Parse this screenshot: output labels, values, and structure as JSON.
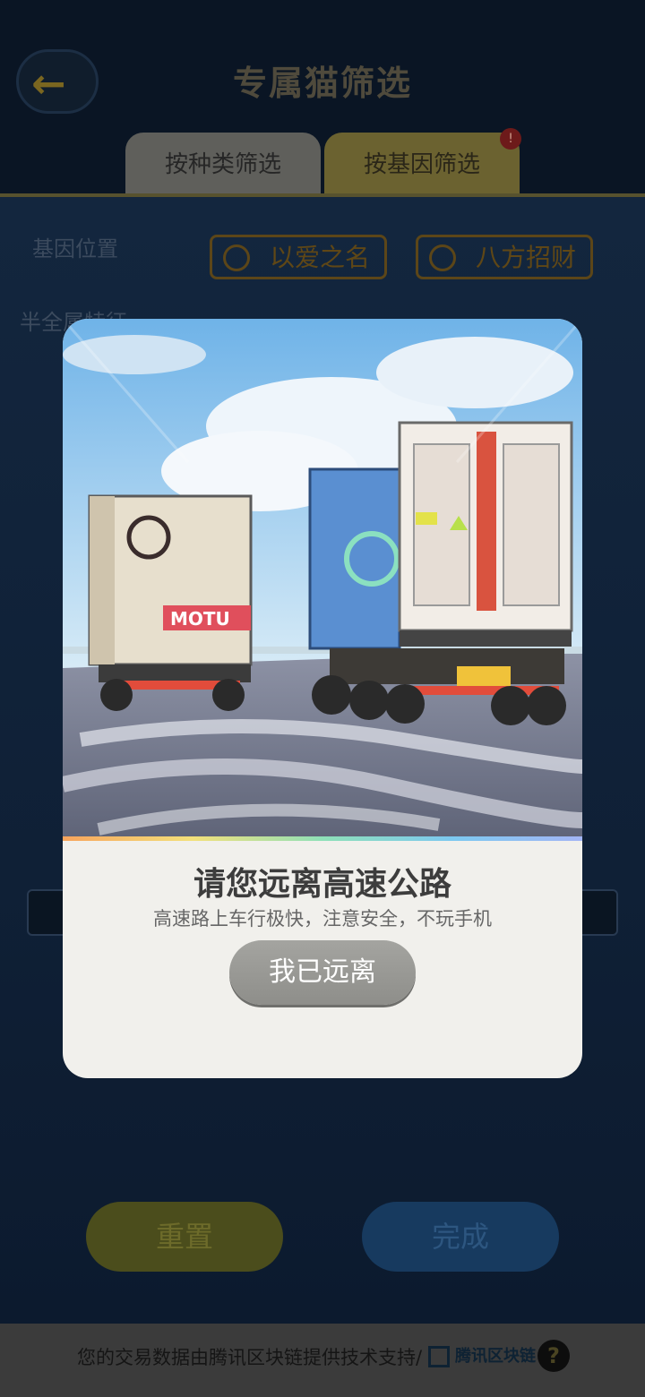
{
  "header": {
    "title": "专属猫筛选",
    "tabs": [
      {
        "label": "按种类筛选"
      },
      {
        "label": "按基因筛选",
        "badge": "!"
      }
    ]
  },
  "filters": {
    "rows": [
      {
        "label": "基因位置"
      },
      {
        "label": "半全属特征"
      }
    ],
    "chips": [
      "以爱之名",
      "八方招财"
    ]
  },
  "actions": {
    "reset_label": "重置",
    "done_label": "完成"
  },
  "footer": {
    "text": "您的交易数据由腾讯区块链提供技术支持/",
    "logo_text": "腾讯区块链",
    "help_icon": "?"
  },
  "modal": {
    "title": "请您远离高速公路",
    "description": "高速路上车行极快，注意安全，不玩手机",
    "button_label": "我已远离",
    "illustration": {
      "truck_left_logo_text": "MOTU"
    }
  },
  "colors": {
    "accent_yellow": "#f3c11d",
    "accent_blue": "#2d7bd1",
    "modal_bg": "#f1f0ec"
  }
}
